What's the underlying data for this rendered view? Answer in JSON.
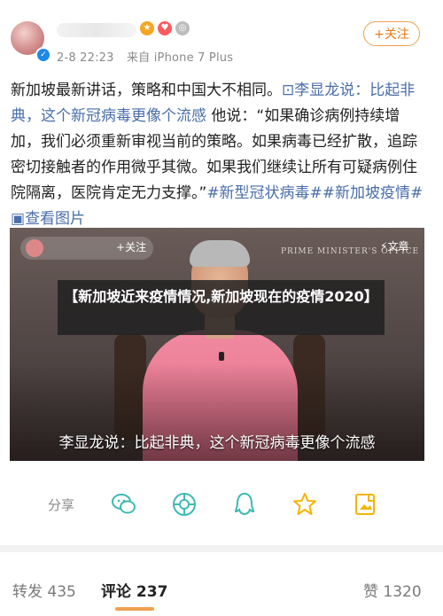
{
  "header": {
    "timestamp": "2-8 22:23",
    "source": "来自 iPhone 7 Plus",
    "follow_label": "+关注"
  },
  "post": {
    "line1": "新加坡最新讲话，策略和中国大不相同。",
    "link_title": "李显龙说：比起非典，这个新冠病毒更像个流感",
    "body": "他说：“如果确诊病例持续增加，我们必须重新审视当前的策略。如果病毒已经扩散，追踪密切接触者的作用微乎其微。如果我们继续让所有可疑病例住院隔离，医院肯定无力支撑。”",
    "hashtags": "#新型冠状病毒##新加坡疫情#",
    "view_image": "查看图片"
  },
  "video": {
    "follow_label": "关注",
    "channel_text": "PRIME MINISTER'S OFFICE",
    "article_label": "文章",
    "subtitle": "李显龙说：比起非典，这个新冠病毒更像个流感"
  },
  "overlay_title": "【新加坡近来疫情情况,新加坡现在的疫情2020】",
  "share": {
    "label": "分享",
    "icons": [
      "wechat-icon",
      "moments-icon",
      "qq-icon",
      "qzone-star-icon",
      "save-image-icon"
    ]
  },
  "bottom": {
    "repost_label": "转发 435",
    "comment_label": "评论 237",
    "like_label": "赞 1320"
  },
  "colors": {
    "accent": "#f0a050",
    "link": "#4a6ea9",
    "share_icon": "#3dbbb0"
  }
}
